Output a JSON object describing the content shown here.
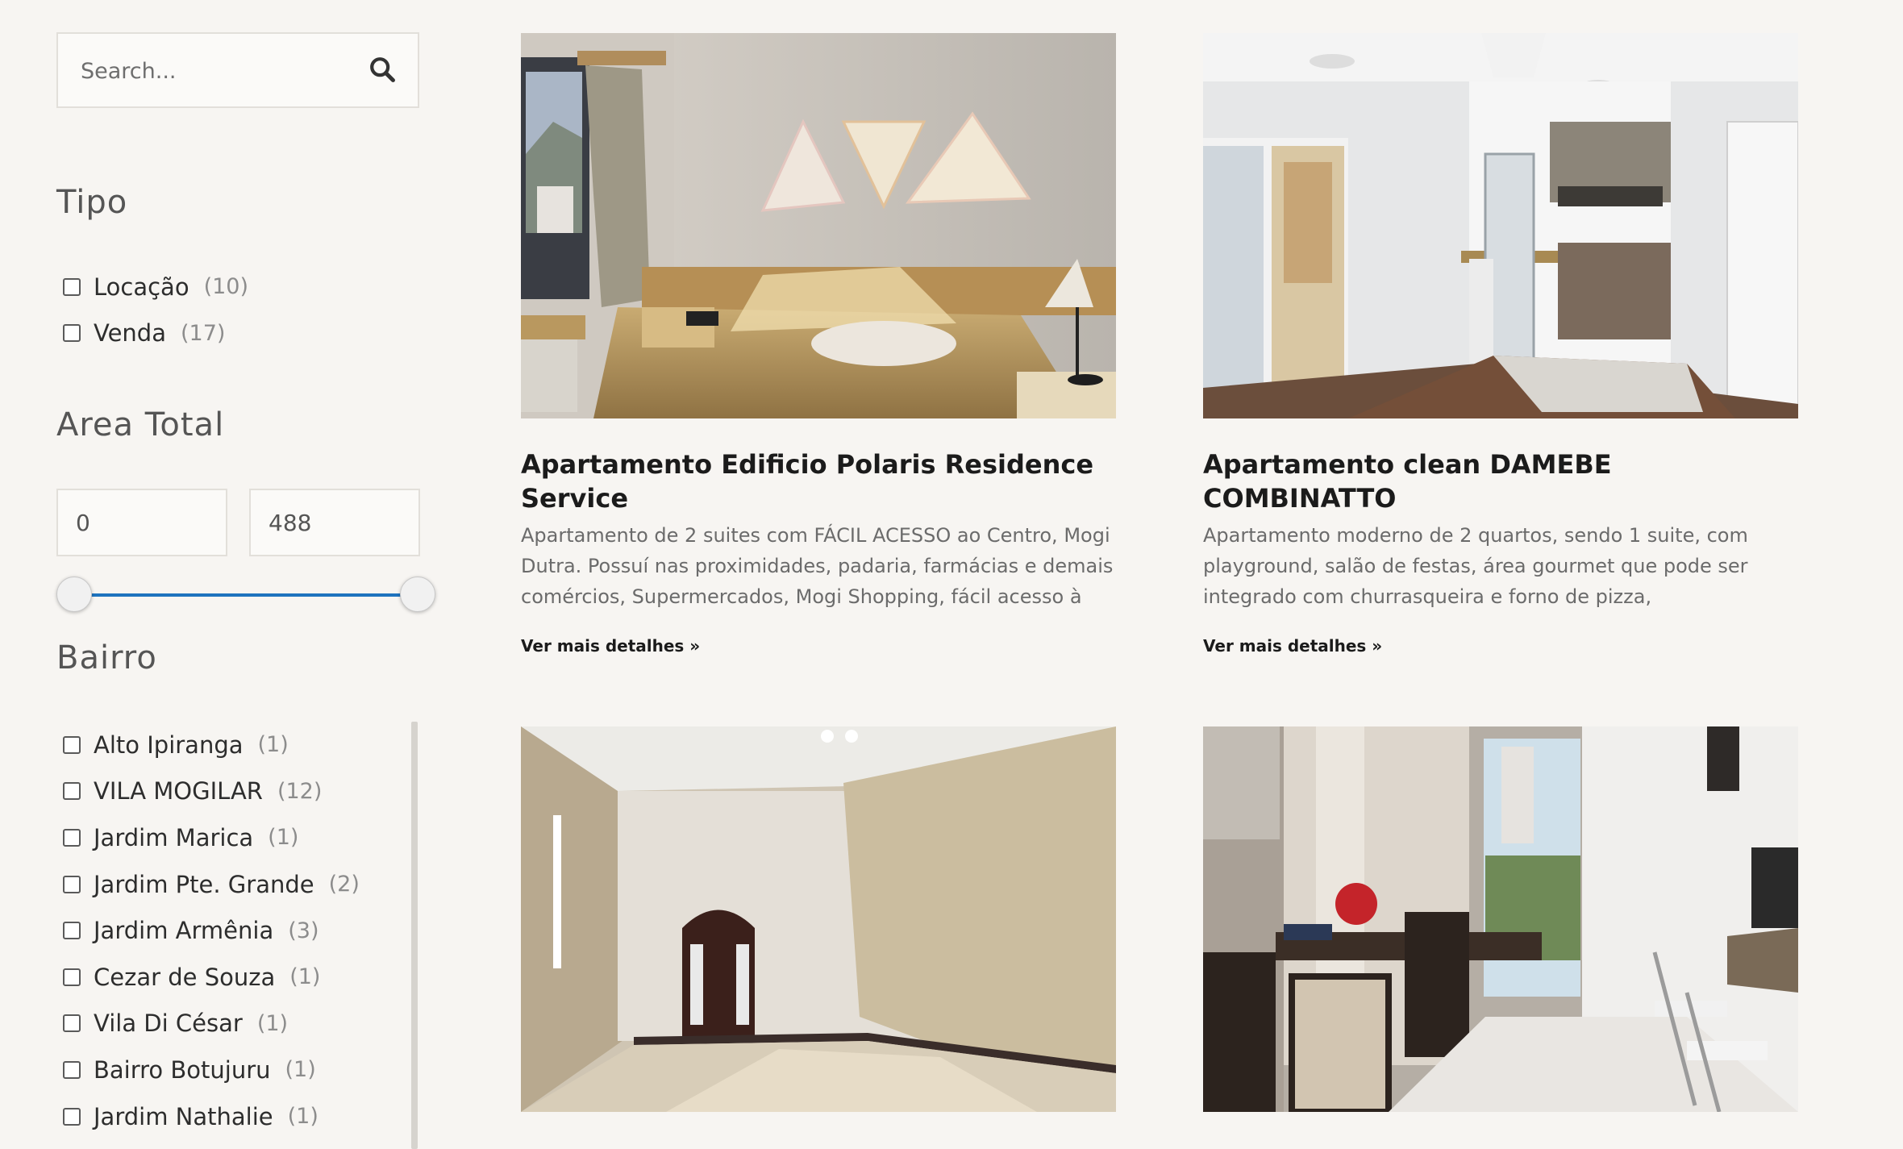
{
  "search": {
    "placeholder": "Search..."
  },
  "filters": {
    "tipo": {
      "heading": "Tipo",
      "options": [
        {
          "label": "Locação",
          "count": "(10)"
        },
        {
          "label": "Venda",
          "count": "(17)"
        }
      ]
    },
    "area": {
      "heading": "Area Total",
      "min": "0",
      "max": "488"
    },
    "bairro": {
      "heading": "Bairro",
      "options": [
        {
          "label": "Alto Ipiranga",
          "count": "(1)"
        },
        {
          "label": "VILA MOGILAR",
          "count": "(12)"
        },
        {
          "label": "Jardim Marica",
          "count": "(1)"
        },
        {
          "label": "Jardim Pte. Grande",
          "count": "(2)"
        },
        {
          "label": "Jardim Armênia",
          "count": "(3)"
        },
        {
          "label": "Cezar de Souza",
          "count": "(1)"
        },
        {
          "label": "Vila Di César",
          "count": "(1)"
        },
        {
          "label": "Bairro Botujuru",
          "count": "(1)"
        },
        {
          "label": "Jardim Nathalie",
          "count": "(1)"
        }
      ]
    }
  },
  "listings": [
    {
      "title": "Apartamento Edificio Polaris Residence Service",
      "description": "Apartamento de 2 suites com FÁCIL ACESSO ao Centro, Mogi Dutra. Possuí nas proximidades, padaria, farmácias e demais comércios, Supermercados, Mogi Shopping, fácil acesso à",
      "link": "Ver mais detalhes »"
    },
    {
      "title": "Apartamento clean DAMEBE COMBINATTO",
      "description": "Apartamento moderno de 2 quartos, sendo 1 suite,  com playground, salão de festas, área gourmet  que pode ser integrado com churrasqueira e forno de pizza,",
      "link": "Ver mais detalhes »"
    }
  ],
  "colors": {
    "background": "#f7f5f2",
    "slider": "#1e73be"
  }
}
